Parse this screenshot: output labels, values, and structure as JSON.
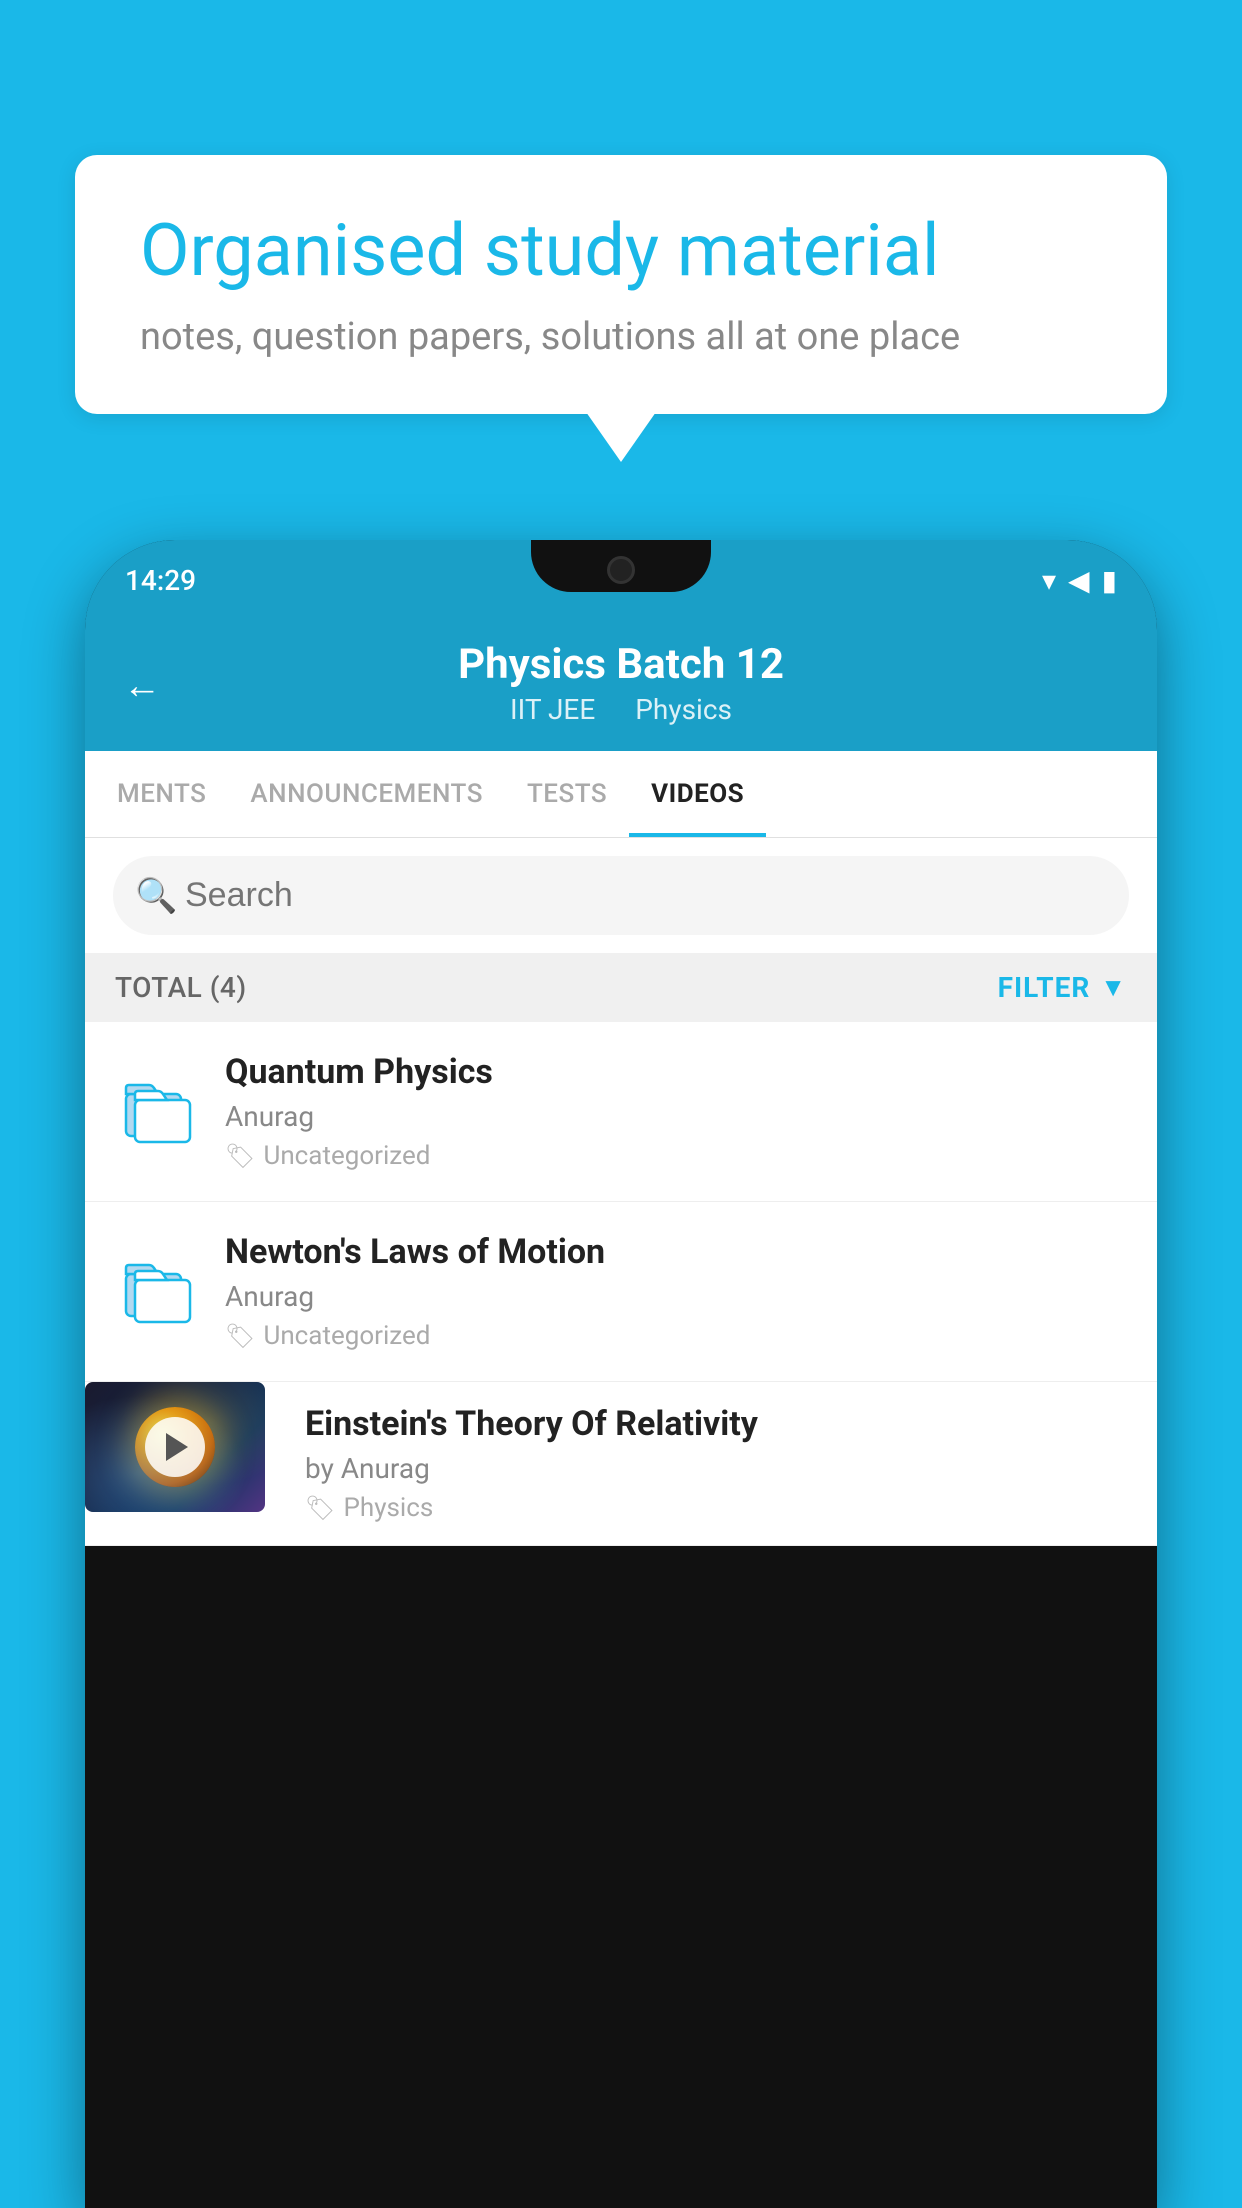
{
  "background_color": "#1ab8e8",
  "speech_bubble": {
    "title": "Organised study material",
    "subtitle": "notes, question papers, solutions all at one place"
  },
  "status_bar": {
    "time": "14:29",
    "wifi": "▾",
    "signal": "▲",
    "battery": "▌"
  },
  "app_header": {
    "back_label": "←",
    "title": "Physics Batch 12",
    "subtitle_left": "IIT JEE",
    "subtitle_right": "Physics"
  },
  "tabs": [
    {
      "label": "MENTS",
      "active": false
    },
    {
      "label": "ANNOUNCEMENTS",
      "active": false
    },
    {
      "label": "TESTS",
      "active": false
    },
    {
      "label": "VIDEOS",
      "active": true
    }
  ],
  "search": {
    "placeholder": "Search"
  },
  "filter_row": {
    "total_label": "TOTAL (4)",
    "filter_label": "FILTER"
  },
  "videos": [
    {
      "id": 1,
      "title": "Quantum Physics",
      "author": "Anurag",
      "tag": "Uncategorized",
      "type": "folder",
      "has_thumbnail": false
    },
    {
      "id": 2,
      "title": "Newton's Laws of Motion",
      "author": "Anurag",
      "tag": "Uncategorized",
      "type": "folder",
      "has_thumbnail": false
    },
    {
      "id": 3,
      "title": "Einstein's Theory Of Relativity",
      "author": "by Anurag",
      "tag": "Physics",
      "type": "video",
      "has_thumbnail": true
    }
  ]
}
